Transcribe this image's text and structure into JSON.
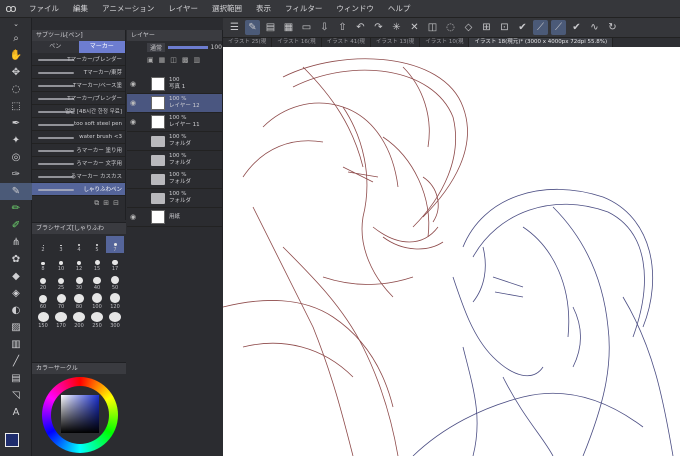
{
  "menu": [
    "ファイル",
    "編集",
    "アニメーション",
    "レイヤー",
    "選択範囲",
    "表示",
    "フィルター",
    "ウィンドウ",
    "ヘルプ"
  ],
  "tabs": [
    "イラスト 25(現",
    "イラスト 16(現",
    "イラスト 41(現",
    "イラスト 13(現",
    "イラスト 10(現",
    "イラスト 18(現元)* (3000 x 4000px 72dpi 55.8%)"
  ],
  "subtool": {
    "header": "サブツール[ペン]",
    "tab_pen": "ペン",
    "tab_marker": "マーカー",
    "brushes": [
      "Tマーカー/ブレンダー",
      "Tマーカー/東芽",
      "Tマーカー/ベース塗",
      "Tマーカー/ブレンダー",
      "멀렌 [48시간 한정 무료]",
      "too soft steel pen",
      "water brush <3",
      "ろマーカー 塗り用",
      "ろマーカー 文字用",
      "ろマーカー カスカス",
      "しゃりふわペン"
    ]
  },
  "layer": {
    "header": "レイヤー",
    "blend": "通常",
    "opacity": "100",
    "rows": [
      {
        "pct": "100",
        "name": "写真 1",
        "type": "layer"
      },
      {
        "pct": "100 %",
        "name": "レイヤー 12",
        "type": "layer"
      },
      {
        "pct": "100 %",
        "name": "レイヤー 11",
        "type": "layer"
      },
      {
        "pct": "100 %",
        "name": "フォルダ",
        "type": "folder"
      },
      {
        "pct": "100 %",
        "name": "フォルダ",
        "type": "folder"
      },
      {
        "pct": "100 %",
        "name": "フォルダ",
        "type": "folder"
      },
      {
        "pct": "100 %",
        "name": "フォルダ",
        "type": "folder"
      },
      {
        "pct": "",
        "name": "用紙",
        "type": "paper"
      }
    ]
  },
  "brush_size": {
    "header": "ブラシサイズ[しゃりふわ",
    "sizes": [
      "2",
      "3",
      "4",
      "5",
      "7",
      "8",
      "10",
      "12",
      "15",
      "17",
      "20",
      "25",
      "30",
      "40",
      "50",
      "60",
      "70",
      "80",
      "100",
      "120",
      "150",
      "170",
      "200",
      "250",
      "300"
    ]
  },
  "color": {
    "header": "カラーサークル",
    "main": "#1f2d6e",
    "sub": "#ffffff"
  }
}
